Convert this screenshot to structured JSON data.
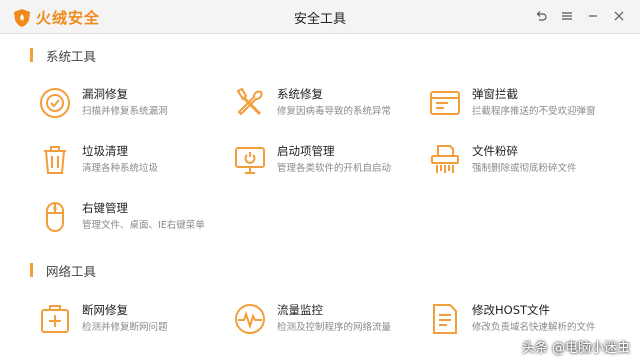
{
  "window": {
    "brand": "火绒安全",
    "title": "安全工具",
    "controls": [
      "back-icon",
      "menu-icon",
      "minimize-icon",
      "close-icon"
    ]
  },
  "sections": [
    {
      "title": "系统工具",
      "tools": [
        {
          "name": "漏洞修复",
          "desc": "扫描并修复系统漏洞",
          "icon": "shield-scan-icon"
        },
        {
          "name": "系统修复",
          "desc": "修复因病毒导致的系统异常",
          "icon": "wrench-screwdriver-icon"
        },
        {
          "name": "弹窗拦截",
          "desc": "拦截程序推送的不受欢迎弹窗",
          "icon": "window-icon"
        },
        {
          "name": "垃圾清理",
          "desc": "清理各种系统垃圾",
          "icon": "trash-icon"
        },
        {
          "name": "启动项管理",
          "desc": "管理各类软件的开机自启动",
          "icon": "monitor-power-icon"
        },
        {
          "name": "文件粉碎",
          "desc": "强制删除或彻底粉碎文件",
          "icon": "shredder-icon"
        },
        {
          "name": "右键管理",
          "desc": "管理文件、桌面、IE右键菜单",
          "icon": "mouse-icon"
        }
      ]
    },
    {
      "title": "网络工具",
      "tools": [
        {
          "name": "断网修复",
          "desc": "检测并修复断网问题",
          "icon": "medical-kit-icon"
        },
        {
          "name": "流量监控",
          "desc": "检测及控制程序的网络流量",
          "icon": "pulse-monitor-icon"
        },
        {
          "name": "修改HOST文件",
          "desc": "修改负责域名快速解析的文件",
          "icon": "document-icon"
        }
      ]
    }
  ],
  "watermark": "头条 @电脑小迷虫",
  "colors": {
    "accent": "#f29e3a",
    "brand": "#f08a1c",
    "titlebar": "#f4f4f4"
  }
}
